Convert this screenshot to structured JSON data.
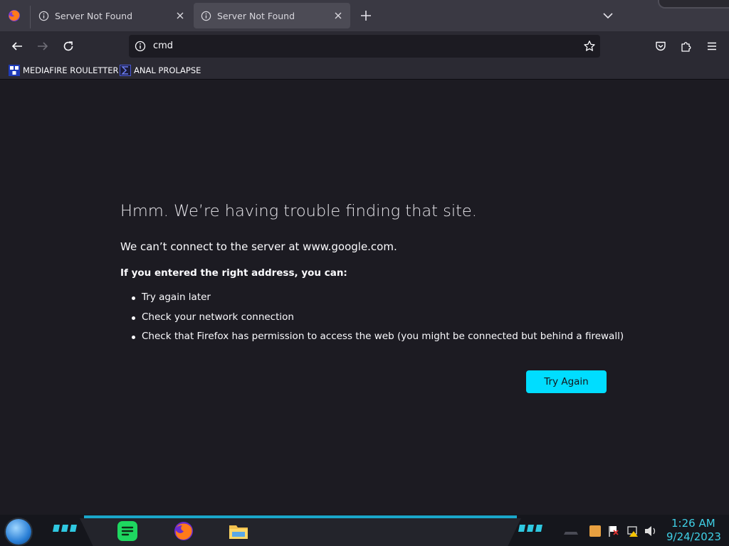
{
  "browser": {
    "tabs": [
      {
        "title": "Server Not Found"
      },
      {
        "title": "Server Not Found"
      }
    ],
    "url": "cmd"
  },
  "bookmarks": [
    {
      "label": "MEDIAFIRE ROULETTER"
    },
    {
      "label": "ANAL PROLAPSE"
    }
  ],
  "error_page": {
    "title": "Hmm. We’re having trouble finding that site.",
    "description": "We can’t connect to the server at www.google.com.",
    "suggestion_heading": "If you entered the right address, you can:",
    "suggestions": [
      "Try again later",
      "Check your network connection",
      "Check that Firefox has permission to access the web (you might be connected but behind a firewall)"
    ],
    "button_label": "Try Again"
  },
  "taskbar": {
    "clock_time": "1:26 AM",
    "clock_date": "9/24/2023"
  },
  "colors": {
    "accent": "#00ddff",
    "page_background": "#1c1b22",
    "toolbar": "#2b2a33",
    "clock": "#3fd0e6"
  }
}
